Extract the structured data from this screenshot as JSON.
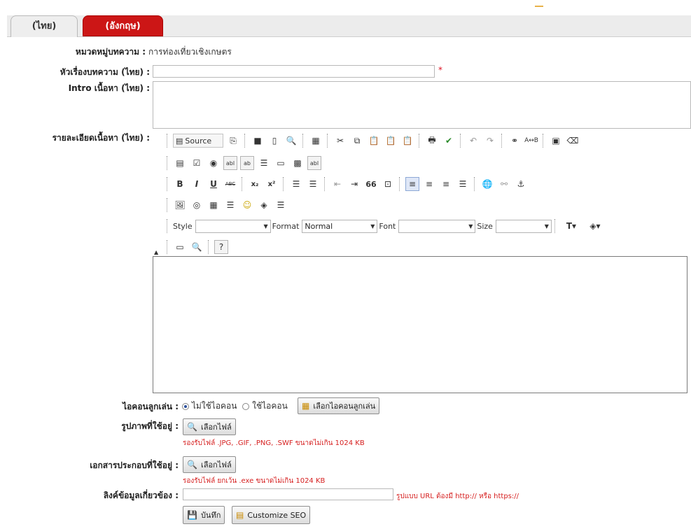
{
  "tabs": {
    "thai": "(ไทย)",
    "english": "(อังกฤษ)"
  },
  "form": {
    "category_label": "หมวดหมู่บทความ :",
    "category_value": "การท่องเที่ยวเชิงเกษตร",
    "title_label": "หัวเรื่องบทความ (ไทย) :",
    "title_value": "",
    "required_mark": "*",
    "intro_label": "Intro เนื้อหา (ไทย) :",
    "intro_value": "",
    "detail_label": "รายละเอียดเนื้อหา (ไทย) :",
    "icon_label": "ไอคอนลูกเล่น :",
    "icon_option_none": "ไม่ใช้ไอคอน",
    "icon_option_use": "ใช้ไอคอน",
    "icon_choose_button": "เลือกไอคอนลูกเล่น",
    "image_label": "รูปภาพที่ใช้อยู่ :",
    "image_choose_button": "เลือกไฟล์",
    "image_hint": "รองรับไฟล์ .JPG, .GIF, .PNG, .SWF ขนาดไม่เกิน 1024 KB",
    "attach_label": "เอกสารประกอบที่ใช้อยู่ :",
    "attach_choose_button": "เลือกไฟล์",
    "attach_hint": "รองรับไฟล์ ยกเว้น .exe ขนาดไม่เกิน 1024 KB",
    "link_label": "ลิงค์ข้อมูลเกี่ยวข้อง :",
    "link_value": "",
    "link_hint": "รูปแบบ URL ต้องมี http:// หรือ https://",
    "save_button": "บันทึก",
    "seo_button": "Customize SEO"
  },
  "editor": {
    "source_label": "Source",
    "style_label": "Style",
    "style_value": "",
    "format_label": "Format",
    "format_value": "Normal",
    "font_label": "Font",
    "font_value": "",
    "size_label": "Size",
    "size_value": "",
    "bold": "B",
    "italic": "I",
    "underline": "U",
    "strike": "ABC",
    "subscript": "x₂",
    "superscript": "x²",
    "quote": "66",
    "help": "?"
  },
  "colors": {
    "tab_active_red": "#cc1616",
    "hint_red": "#d62020",
    "highlight_blue": "#dfe7f7"
  }
}
